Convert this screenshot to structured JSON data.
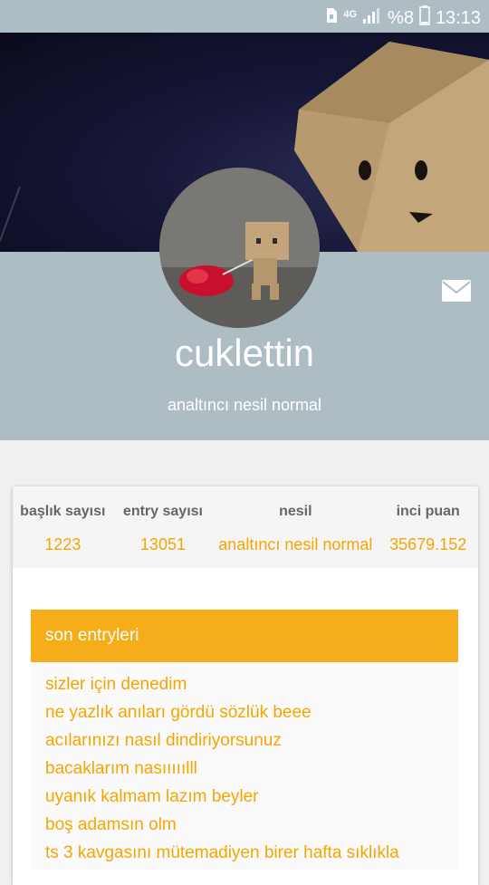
{
  "status_bar": {
    "network": "4G",
    "battery": "%8",
    "time": "13:13"
  },
  "profile": {
    "username": "cuklettin",
    "subtitle": "analtıncı nesil normal",
    "cover_image": "danbo-cardboard-face",
    "avatar_image": "danbo-pulling-rose"
  },
  "stats": [
    {
      "label": "başlık sayısı",
      "value": "1223"
    },
    {
      "label": "entry sayısı",
      "value": "13051"
    },
    {
      "label": "nesil",
      "value": "analtıncı nesil normal"
    },
    {
      "label": "inci puan",
      "value": "35679.152"
    }
  ],
  "recent": {
    "title": "son entryleri",
    "items": [
      "sizler için denedim",
      "ne yazlık anıları gördü sözlük beee",
      "acılarınızı nasıl dindiriyorsunuz",
      "bacaklarım nasııııılll",
      "uyanık kalmam lazım beyler",
      "boş adamsın olm",
      "ts 3 kavgasını mütemadiyen birer hafta sıklıkla"
    ]
  },
  "colors": {
    "header_gray": "#aebcc4",
    "accent": "#f5ad1a",
    "entry_text": "#f5a500"
  },
  "icons": [
    "sim-card-icon",
    "signal-icon",
    "battery-icon",
    "mail-icon"
  ]
}
